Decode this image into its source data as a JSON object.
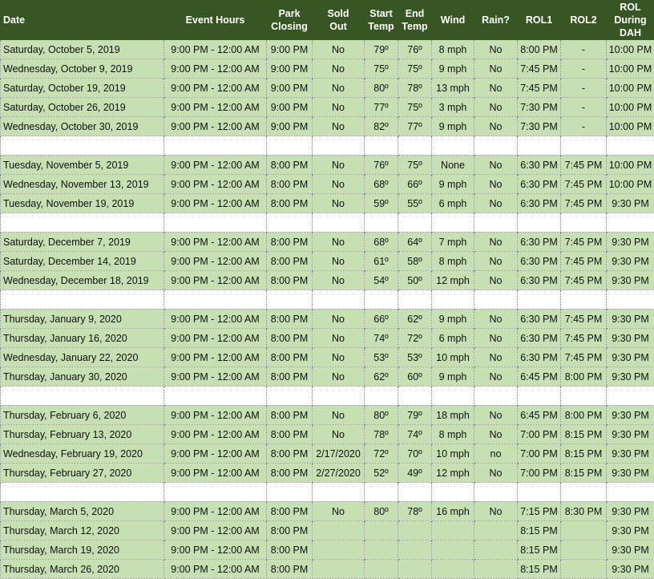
{
  "colors": {
    "header_bg": "#375623",
    "header_text": "#ffffff",
    "row_bg": "#c6e0b4",
    "spacer_bg": "#ffffff"
  },
  "columns": [
    "Date",
    "Event Hours",
    "Park\nClosing",
    "Sold\nOut",
    "Start\nTemp",
    "End\nTemp",
    "Wind",
    "Rain?",
    "ROL1",
    "ROL2",
    "ROL\nDuring\nDAH"
  ],
  "rows": [
    {
      "type": "data",
      "cells": [
        "Saturday, October 5, 2019",
        "9:00 PM - 12:00 AM",
        "9:00 PM",
        "No",
        "79º",
        "76º",
        "8 mph",
        "No",
        "8:00 PM",
        "-",
        "10:00 PM"
      ]
    },
    {
      "type": "data",
      "cells": [
        "Wednesday, October 9, 2019",
        "9:00 PM - 12:00 AM",
        "9:00 PM",
        "No",
        "75º",
        "75º",
        "9 mph",
        "No",
        "7:45 PM",
        "-",
        "10:00 PM"
      ]
    },
    {
      "type": "data",
      "cells": [
        "Saturday, October 19, 2019",
        "9:00 PM - 12:00 AM",
        "9:00 PM",
        "No",
        "80º",
        "78º",
        "13 mph",
        "No",
        "7:45 PM",
        "-",
        "10:00 PM"
      ]
    },
    {
      "type": "data",
      "cells": [
        "Saturday, October 26, 2019",
        "9:00 PM - 12:00 AM",
        "9:00 PM",
        "No",
        "77º",
        "75º",
        "3 mph",
        "No",
        "7:30 PM",
        "-",
        "10:00 PM"
      ]
    },
    {
      "type": "data",
      "cells": [
        "Wednesday, October 30, 2019",
        "9:00 PM - 12:00 AM",
        "9:00 PM",
        "No",
        "82º",
        "77º",
        "9 mph",
        "No",
        "7:30 PM",
        "-",
        "10:00 PM"
      ]
    },
    {
      "type": "spacer"
    },
    {
      "type": "data",
      "cells": [
        "Tuesday, November 5, 2019",
        "9:00 PM - 12:00 AM",
        "8:00 PM",
        "No",
        "76º",
        "75º",
        "None",
        "No",
        "6:30 PM",
        "7:45 PM",
        "10:00 PM"
      ]
    },
    {
      "type": "data",
      "cells": [
        "Wednesday, November 13, 2019",
        "9:00 PM - 12:00 AM",
        "8:00 PM",
        "No",
        "68º",
        "66º",
        "9 mph",
        "No",
        "6:30 PM",
        "7:45 PM",
        "10:00 PM"
      ]
    },
    {
      "type": "data",
      "cells": [
        "Tuesday, November 19, 2019",
        "9:00 PM - 12:00 AM",
        "8:00 PM",
        "No",
        "59º",
        "55º",
        "6 mph",
        "No",
        "6:30 PM",
        "7:45 PM",
        "9:30 PM"
      ]
    },
    {
      "type": "spacer"
    },
    {
      "type": "data",
      "cells": [
        "Saturday, December 7, 2019",
        "9:00 PM - 12:00 AM",
        "8:00 PM",
        "No",
        "68º",
        "64º",
        "7 mph",
        "No",
        "6:30 PM",
        "7:45 PM",
        "9:30 PM"
      ]
    },
    {
      "type": "data",
      "cells": [
        "Saturday, December 14, 2019",
        "9:00 PM - 12:00 AM",
        "8:00 PM",
        "No",
        "61º",
        "58º",
        "8 mph",
        "No",
        "6:30 PM",
        "7:45 PM",
        "9:30 PM"
      ]
    },
    {
      "type": "data",
      "cells": [
        "Wednesday, December 18, 2019",
        "9:00 PM - 12:00 AM",
        "8:00 PM",
        "No",
        "54º",
        "50º",
        "12 mph",
        "No",
        "6:30 PM",
        "7:45 PM",
        "9:30 PM"
      ]
    },
    {
      "type": "spacer"
    },
    {
      "type": "data",
      "cells": [
        "Thursday, January 9, 2020",
        "9:00 PM - 12:00 AM",
        "8:00 PM",
        "No",
        "66º",
        "62º",
        "9 mph",
        "No",
        "6:30 PM",
        "7:45 PM",
        "9:30 PM"
      ]
    },
    {
      "type": "data",
      "cells": [
        "Thursday, January 16, 2020",
        "9:00 PM - 12:00 AM",
        "8:00 PM",
        "No",
        "74º",
        "72º",
        "6 mph",
        "No",
        "6:30 PM",
        "7:45 PM",
        "9:30 PM"
      ]
    },
    {
      "type": "data",
      "cells": [
        "Wednesday, January 22, 2020",
        "9:00 PM - 12:00 AM",
        "8:00 PM",
        "No",
        "53º",
        "53º",
        "10 mph",
        "No",
        "6:30 PM",
        "7:45 PM",
        "9:30 PM"
      ]
    },
    {
      "type": "data",
      "cells": [
        "Thursday, January 30, 2020",
        "9:00 PM - 12:00 AM",
        "8:00 PM",
        "No",
        "62º",
        "60º",
        "9 mph",
        "No",
        "6:45 PM",
        "8:00 PM",
        "9:30 PM"
      ]
    },
    {
      "type": "spacer"
    },
    {
      "type": "data",
      "cells": [
        "Thursday, February 6, 2020",
        "9:00 PM - 12:00 AM",
        "8:00 PM",
        "No",
        "80º",
        "79º",
        "18 mph",
        "No",
        "6:45 PM",
        "8:00 PM",
        "9:30 PM"
      ]
    },
    {
      "type": "data",
      "cells": [
        "Thursday, February 13, 2020",
        "9:00 PM - 12:00 AM",
        "8:00 PM",
        "No",
        "78º",
        "74º",
        "8 mph",
        "No",
        "7:00 PM",
        "8:15 PM",
        "9:30 PM"
      ]
    },
    {
      "type": "data",
      "cells": [
        "Wednesday, February 19, 2020",
        "9:00 PM - 12:00 AM",
        "8:00 PM",
        "2/17/2020",
        "72º",
        "70º",
        "10 mph",
        "no",
        "7:00 PM",
        "8:15 PM",
        "9:30 PM"
      ]
    },
    {
      "type": "data",
      "cells": [
        "Thursday, February 27, 2020",
        "9:00 PM - 12:00 AM",
        "8:00 PM",
        "2/27/2020",
        "52º",
        "49º",
        "12 mph",
        "No",
        "7:00 PM",
        "8:15 PM",
        "9:30 PM"
      ]
    },
    {
      "type": "spacer"
    },
    {
      "type": "data",
      "cells": [
        "Thursday, March 5, 2020",
        "9:00 PM - 12:00 AM",
        "8:00 PM",
        "No",
        "80º",
        "78º",
        "16 mph",
        "No",
        "7:15 PM",
        "8:30 PM",
        "9:30 PM"
      ]
    },
    {
      "type": "data",
      "cells": [
        "Thursday, March 12, 2020",
        "9:00 PM - 12:00 AM",
        "8:00 PM",
        "",
        "",
        "",
        "",
        "",
        "8:15 PM",
        "",
        "9:30 PM"
      ]
    },
    {
      "type": "data",
      "cells": [
        "Thursday, March 19, 2020",
        "9:00 PM - 12:00 AM",
        "8:00 PM",
        "",
        "",
        "",
        "",
        "",
        "8:15 PM",
        "",
        "9:30 PM"
      ]
    },
    {
      "type": "data",
      "cells": [
        "Thursday, March 26, 2020",
        "9:00 PM - 12:00 AM",
        "8:00 PM",
        "",
        "",
        "",
        "",
        "",
        "8:15 PM",
        "",
        "9:30 PM"
      ]
    }
  ]
}
